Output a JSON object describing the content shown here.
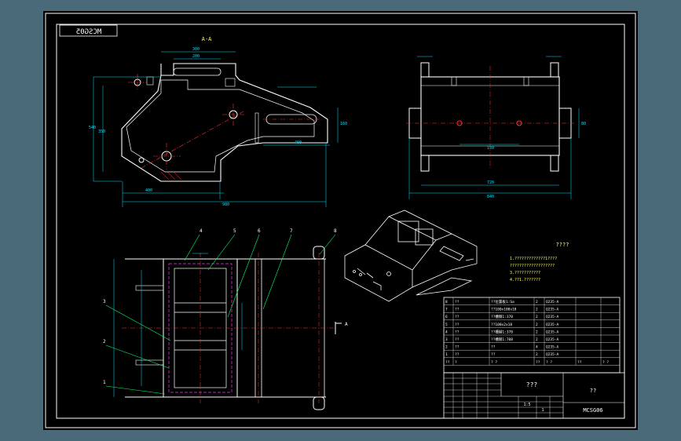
{
  "drawing": {
    "code_mirrored": "MCSG05",
    "section_label": "A-A",
    "cut_arrow_label": "A",
    "iso_title": "????",
    "tech_notes": [
      "1.?????????????1????",
      "???????????????????",
      "3.???????????",
      "4.??1.???????"
    ],
    "balloons": [
      "1",
      "2",
      "3",
      "4",
      "5",
      "6",
      "7",
      "8"
    ]
  },
  "bom": {
    "rows": [
      {
        "no": "8",
        "name": "??",
        "spec": "??位置板1:Sa",
        "qty": "2",
        "material": "Q235-A"
      },
      {
        "no": "7",
        "name": "??",
        "spec": "??100x100x18",
        "qty": "2",
        "material": "Q235-A"
      },
      {
        "no": "6",
        "name": "??",
        "spec": "??槽钢1:370",
        "qty": "2",
        "material": "Q235-A"
      },
      {
        "no": "5",
        "name": "??",
        "spec": "??100x2x18",
        "qty": "2",
        "material": "Q235-A"
      },
      {
        "no": "4",
        "name": "??",
        "spec": "??槽钢1:370",
        "qty": "2",
        "material": "Q235-A"
      },
      {
        "no": "3",
        "name": "??",
        "spec": "??槽钢1:708",
        "qty": "2",
        "material": "Q235-A"
      },
      {
        "no": "2",
        "name": "??",
        "spec": "??",
        "qty": "4",
        "material": "Q235-A"
      },
      {
        "no": "1",
        "name": "??",
        "spec": "??",
        "qty": "2",
        "material": "Q235-A"
      }
    ],
    "header": {
      "no": "??",
      "name": "?",
      "spec": "? ?",
      "qty": "??",
      "material": "? ?",
      "weight": "??",
      "note": "? ?"
    }
  },
  "title_block": {
    "part_name": "???",
    "company": "??",
    "drawing_code": "MCSG06",
    "scale": "1:5",
    "sheet_count": "1",
    "cells": [
      "??",
      "??",
      "??",
      "??",
      "??",
      "??",
      "???",
      "??",
      "??",
      "???"
    ]
  },
  "colors": {
    "frame": "#ffffff",
    "outline": "#ffffff",
    "dimension": "#00e5ff",
    "centerline": "#ff3333",
    "hidden": "#ff33ff",
    "balloon_leader": "#00ff66",
    "hatch": "#ff4444"
  }
}
